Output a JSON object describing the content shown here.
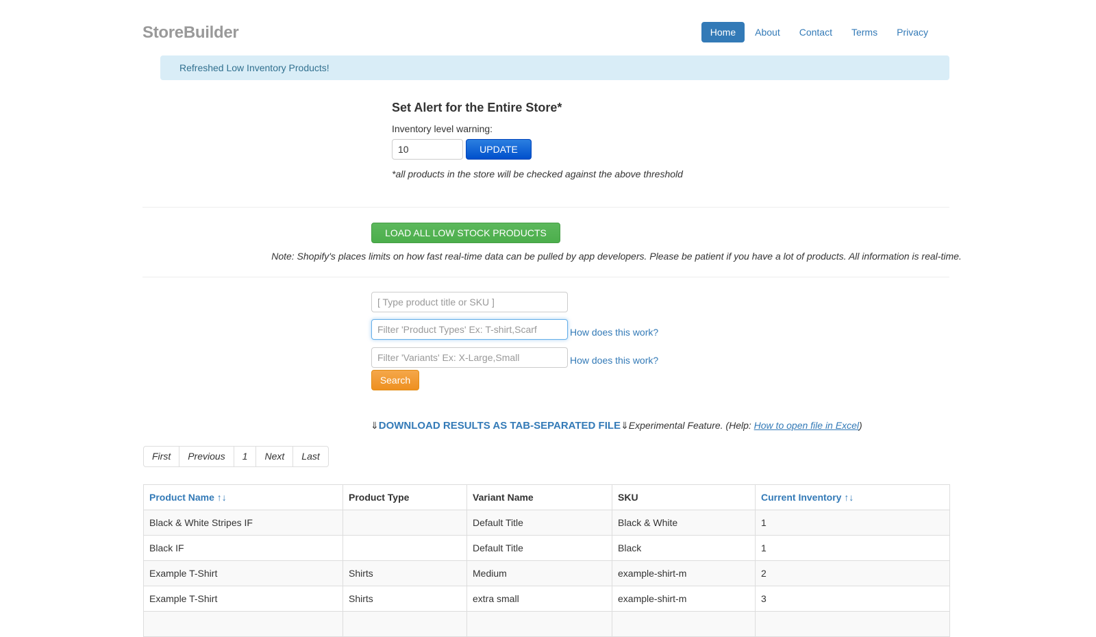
{
  "header": {
    "brand": "StoreBuilder",
    "nav": [
      {
        "label": "Home",
        "active": true
      },
      {
        "label": "About",
        "active": false
      },
      {
        "label": "Contact",
        "active": false
      },
      {
        "label": "Terms",
        "active": false
      },
      {
        "label": "Privacy",
        "active": false
      }
    ]
  },
  "alert": {
    "message": "Refreshed Low Inventory Products!"
  },
  "store_alert": {
    "title": "Set Alert for the Entire Store*",
    "label": "Inventory level warning:",
    "threshold_value": "10",
    "update_label": "UPDATE",
    "note": "*all products in the store will be checked against the above threshold"
  },
  "load": {
    "button_label": "LOAD ALL LOW STOCK PRODUCTS",
    "note": "Note: Shopify's places limits on how fast real-time data can be pulled by app developers. Please be patient if you have a lot of products. All information is real-time."
  },
  "search": {
    "title_placeholder": "[ Type product title or SKU ]",
    "types_placeholder": "Filter 'Product Types' Ex: T-shirt,Scarf",
    "variants_placeholder": "Filter 'Variants' Ex: X-Large,Small",
    "help_label": "How does this work?",
    "search_label": "Search"
  },
  "download": {
    "arrow": "⇓",
    "label": "DOWNLOAD RESULTS AS TAB-SEPARATED FILE",
    "experimental": "Experimental Feature. (Help: ",
    "help_link": "How to open file in Excel",
    "close_paren": ")"
  },
  "pagination": [
    "First",
    "Previous",
    "1",
    "Next",
    "Last"
  ],
  "table": {
    "columns": [
      {
        "label": "Product Name ↑↓",
        "sortable": true
      },
      {
        "label": "Product Type",
        "sortable": false
      },
      {
        "label": "Variant Name",
        "sortable": false
      },
      {
        "label": "SKU",
        "sortable": false
      },
      {
        "label": "Current Inventory ↑↓",
        "sortable": true
      }
    ],
    "rows": [
      [
        "Black & White Stripes IF",
        "",
        "Default Title",
        "Black & White",
        "1"
      ],
      [
        "Black IF",
        "",
        "Default Title",
        "Black",
        "1"
      ],
      [
        "Example T-Shirt",
        "Shirts",
        "Medium",
        "example-shirt-m",
        "2"
      ],
      [
        "Example T-Shirt",
        "Shirts",
        "extra small",
        "example-shirt-m",
        "3"
      ],
      [
        "",
        "",
        "",
        "",
        ""
      ]
    ]
  }
}
